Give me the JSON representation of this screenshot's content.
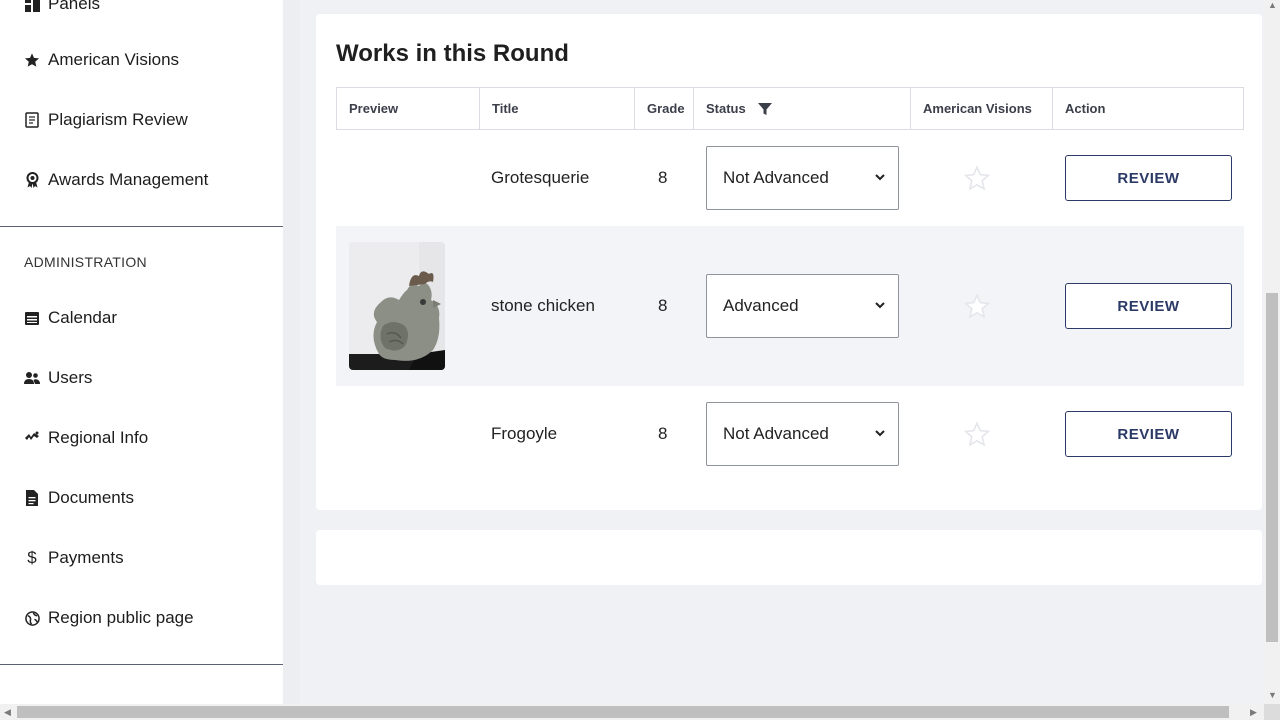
{
  "sidebar": {
    "items_top": [
      {
        "label": "Panels",
        "icon": "panels-icon"
      },
      {
        "label": "American Visions",
        "icon": "star-icon"
      },
      {
        "label": "Plagiarism Review",
        "icon": "document-check-icon"
      },
      {
        "label": "Awards Management",
        "icon": "award-icon"
      }
    ],
    "section_label": "ADMINISTRATION",
    "items_admin": [
      {
        "label": "Calendar",
        "icon": "calendar-icon"
      },
      {
        "label": "Users",
        "icon": "users-icon"
      },
      {
        "label": "Regional Info",
        "icon": "regional-info-icon"
      },
      {
        "label": "Documents",
        "icon": "document-icon"
      },
      {
        "label": "Payments",
        "icon": "dollar-icon",
        "glyph": "$"
      },
      {
        "label": "Region public page",
        "icon": "globe-icon"
      }
    ]
  },
  "works": {
    "heading": "Works in this Round",
    "columns": {
      "preview": "Preview",
      "title": "Title",
      "grade": "Grade",
      "status": "Status",
      "american_visions": "American Visions",
      "action": "Action"
    },
    "rows": [
      {
        "title": "Grotesquerie",
        "grade": "8",
        "status": "Not Advanced",
        "american_visions_selected": false,
        "action": "REVIEW",
        "has_preview": false
      },
      {
        "title": "stone chicken",
        "grade": "8",
        "status": "Advanced",
        "american_visions_selected": false,
        "action": "REVIEW",
        "has_preview": true
      },
      {
        "title": "Frogoyle",
        "grade": "8",
        "status": "Not Advanced",
        "american_visions_selected": false,
        "action": "REVIEW",
        "has_preview": false
      }
    ]
  },
  "colors": {
    "accent": "#2b3a67",
    "sidebar_divider": "#5b6170",
    "row_alt": "#f3f4f8",
    "star_empty": "#e4e6ec"
  }
}
